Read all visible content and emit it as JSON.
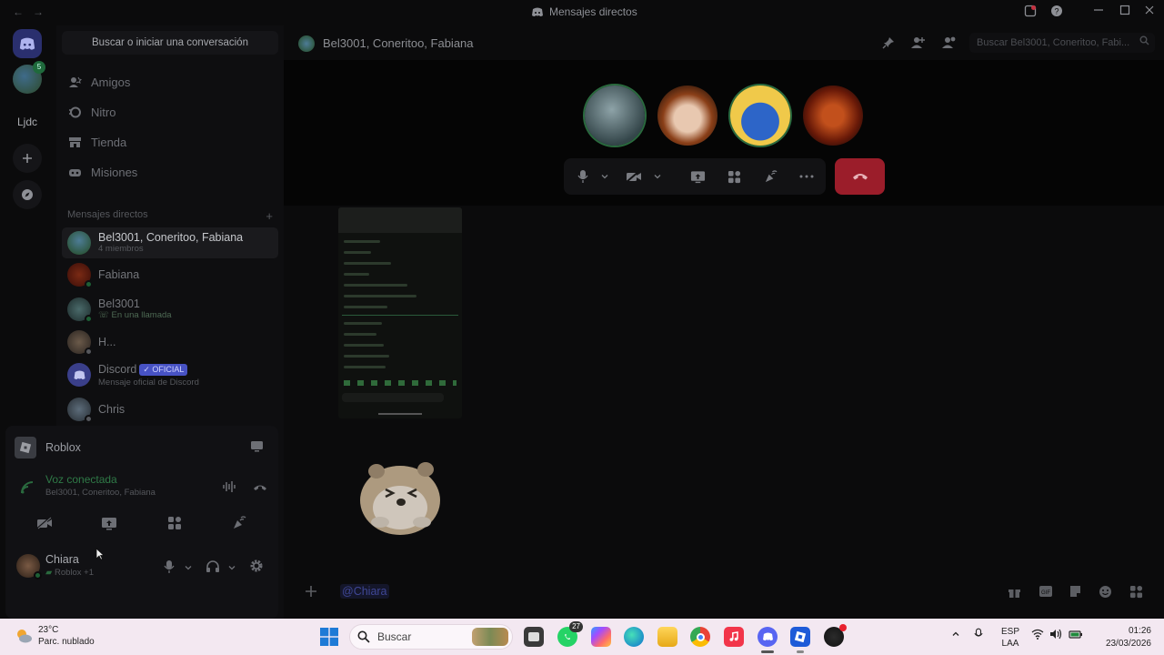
{
  "titlebar": {
    "title": "Mensajes directos",
    "back": "←",
    "forward": "→"
  },
  "rail": {
    "server_label": "Ljdc",
    "server_badge": "5"
  },
  "sidebar": {
    "search_placeholder": "Buscar o iniciar una conversación",
    "nav": [
      {
        "label": "Amigos"
      },
      {
        "label": "Nitro"
      },
      {
        "label": "Tienda"
      },
      {
        "label": "Misiones"
      }
    ],
    "dm_header": "Mensajes directos",
    "dm_add": "+",
    "dms": [
      {
        "name": "Bel3001, Coneritoo, Fabiana",
        "sub": "4 miembros"
      },
      {
        "name": "Fabiana",
        "sub": ""
      },
      {
        "name": "Bel3001",
        "sub": "En una llamada"
      },
      {
        "name": "H...",
        "sub": ""
      },
      {
        "name": "Discord",
        "sub": "Mensaje oficial de Discord",
        "badge": "✓ OFICIAL"
      },
      {
        "name": "Chris",
        "sub": ""
      }
    ]
  },
  "panel": {
    "activity": "Roblox",
    "voice_title": "Voz conectada",
    "voice_sub": "Bel3001, Coneritoo, Fabiana",
    "user_name": "Chiara",
    "user_status": "Roblox +1"
  },
  "main": {
    "channel_title": "Bel3001, Coneritoo, Fabiana",
    "search_placeholder": "Buscar Bel3001, Coneritoo, Fabi...",
    "composer_mention": "@Chiara"
  },
  "taskbar": {
    "temp": "23°C",
    "weather": "Parc. nublado",
    "search": "Buscar",
    "whatsapp_badge": "27",
    "lang1": "ESP",
    "lang2": "LAA",
    "time": "01:26",
    "date": "23/03/2026"
  },
  "colors": {
    "accent": "#5865f2",
    "online": "#23a55a",
    "hangup": "#9b1d2a"
  }
}
